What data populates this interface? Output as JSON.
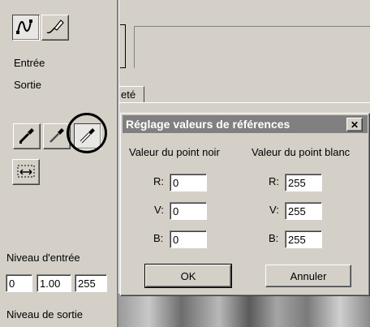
{
  "left_panel": {
    "entree_label": "Entrée",
    "sortie_label": "Sortie",
    "niveau_entree_label": "Niveau d'entrée",
    "niveau_entree_values": [
      "0",
      "1.00",
      "255"
    ],
    "niveau_sortie_label": "Niveau de sortie"
  },
  "background_tab": {
    "label": "eté"
  },
  "dialog": {
    "title": "Réglage valeurs de références",
    "close_glyph": "✕",
    "black_point": {
      "heading": "Valeur du point noir",
      "r_label": "R:",
      "r_value": "0",
      "v_label": "V:",
      "v_value": "0",
      "b_label": "B:",
      "b_value": "0"
    },
    "white_point": {
      "heading": "Valeur du point blanc",
      "r_label": "R:",
      "r_value": "255",
      "v_label": "V:",
      "v_value": "255",
      "b_label": "B:",
      "b_value": "255"
    },
    "ok_label": "OK",
    "cancel_label": "Annuler"
  },
  "colors": {
    "face": "#d4d0c8",
    "title_bar": "#808080",
    "highlight_circle": "#000000"
  }
}
